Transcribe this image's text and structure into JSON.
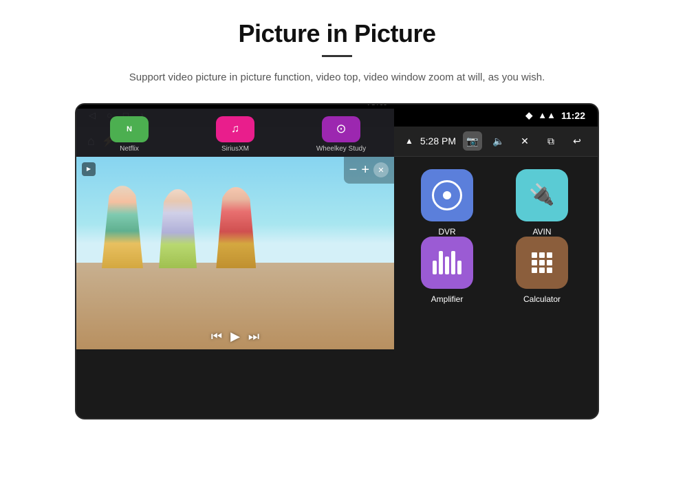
{
  "page": {
    "title": "Picture in Picture",
    "subtitle": "Support video picture in picture function, video top, video window zoom at will, as you wish."
  },
  "statusBar": {
    "time": "11:22",
    "icons": [
      "back-icon",
      "home-circle-icon",
      "square-icon",
      "music-icon"
    ]
  },
  "navBar": {
    "time": "5:28 PM",
    "icons": [
      "home-icon",
      "usb-icon",
      "wifi-icon",
      "camera-icon",
      "volume-icon",
      "close-icon",
      "pip-icon",
      "back-icon"
    ]
  },
  "pipVideo": {
    "indicator": "▶",
    "controls": {
      "minus": "−",
      "plus": "+",
      "close": "✕"
    },
    "playback": {
      "rewind": "⏮",
      "play": "▶",
      "forward": "⏭"
    }
  },
  "apps": [
    {
      "id": "dvr",
      "label": "DVR",
      "color": "#5b7fdb"
    },
    {
      "id": "avin",
      "label": "AVIN",
      "color": "#5acbd4"
    },
    {
      "id": "amplifier",
      "label": "Amplifier",
      "color": "#9b5bd4"
    },
    {
      "id": "calculator",
      "label": "Calculator",
      "color": "#8b5e3c"
    }
  ],
  "bottomApps": [
    {
      "id": "netflix",
      "label": "Netflix",
      "color": "#4caf50"
    },
    {
      "id": "siriusxm",
      "label": "SiriusXM",
      "color": "#e91e8c"
    },
    {
      "id": "wheelkey",
      "label": "Wheelkey Study",
      "color": "#9c27b0"
    }
  ],
  "icons": {
    "home": "⌂",
    "usb": "⚡",
    "back": "◁",
    "circle": "○",
    "square": "□",
    "music": "♪",
    "wifi": "▲",
    "volume": "🔊",
    "camera": "📷",
    "close": "✕",
    "pip": "⧉",
    "undo": "↩",
    "location": "📍"
  }
}
